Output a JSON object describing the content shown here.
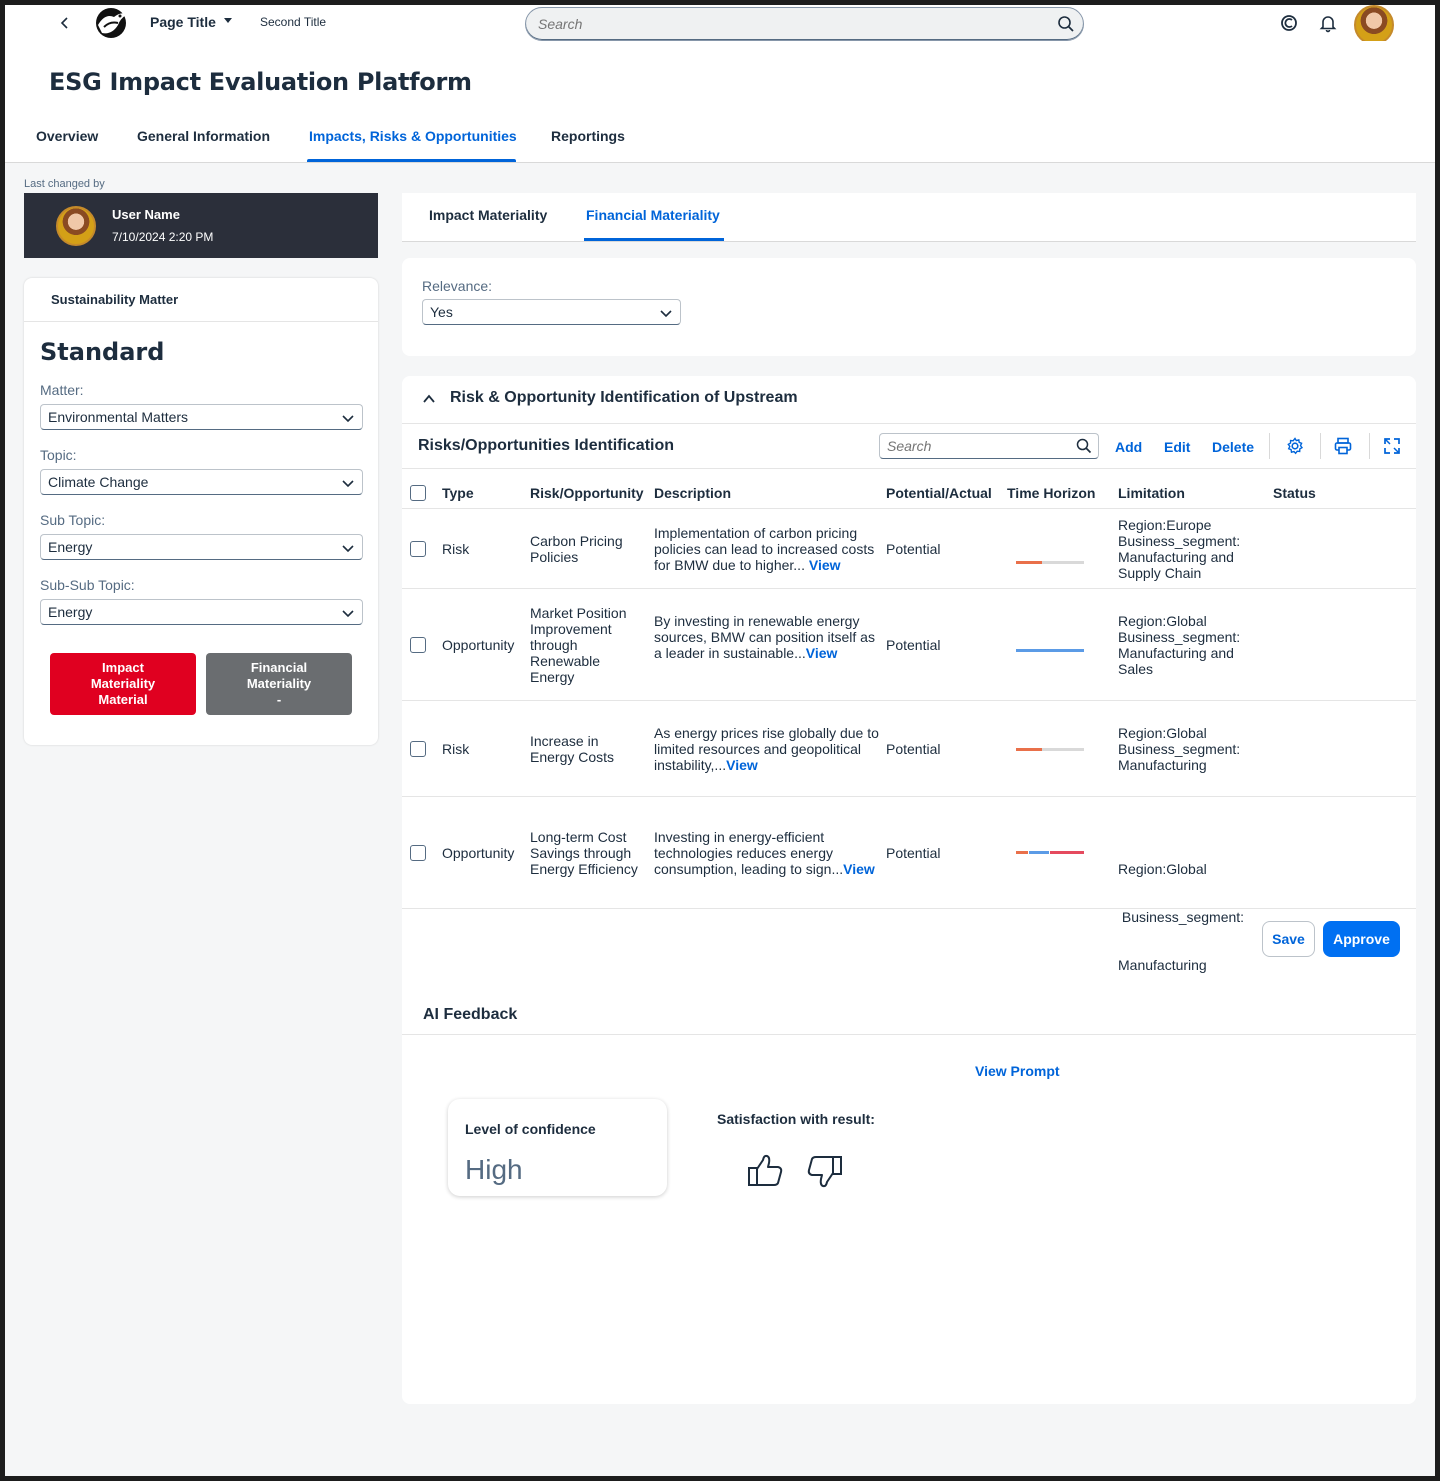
{
  "shell": {
    "page_title": "Page Title",
    "second_title": "Second Title",
    "search_placeholder": "Search"
  },
  "header": {
    "title": "ESG Impact Evaluation Platform"
  },
  "nav": {
    "tabs": [
      {
        "label": "Overview"
      },
      {
        "label": "General Information"
      },
      {
        "label": "Impacts, Risks & Opportunities"
      },
      {
        "label": "Reportings"
      }
    ],
    "active_index": 2
  },
  "left": {
    "last_changed_label": "Last changed by",
    "user_name": "User Name",
    "user_date": "7/10/2024 2:20 PM",
    "card_title": "Sustainability Matter",
    "standard": "Standard",
    "fields": [
      {
        "label": "Matter:",
        "value": "Environmental Matters"
      },
      {
        "label": "Topic:",
        "value": "Climate Change"
      },
      {
        "label": "Sub Topic:",
        "value": "Energy"
      },
      {
        "label": "Sub-Sub Topic:",
        "value": "Energy"
      }
    ],
    "impact_btn": [
      "Impact",
      "Materiality",
      "Material"
    ],
    "financial_btn": [
      "Financial",
      "Materiality",
      "-"
    ]
  },
  "subtabs": {
    "tabs": [
      {
        "label": "Impact Materiality"
      },
      {
        "label": "Financial Materiality"
      }
    ],
    "active_index": 1
  },
  "relevance": {
    "label": "Relevance:",
    "value": "Yes"
  },
  "risk": {
    "section_title": "Risk & Opportunity Identification of Upstream",
    "table_title": "Risks/Opportunities Identification",
    "search_placeholder": "Search",
    "actions": {
      "add": "Add",
      "edit": "Edit",
      "delete": "Delete"
    },
    "columns": [
      "Type",
      "Risk/Opportunity",
      "Description",
      "Potential/Actual",
      "Time Horizon",
      "Limitation",
      "Status"
    ],
    "view_label": "View",
    "rows": [
      {
        "type": "Risk",
        "name": [
          "Carbon Pricing",
          "Policies"
        ],
        "desc": [
          "Implementation of carbon pricing",
          "policies can lead to increased costs",
          "for BMW due to higher... "
        ],
        "potential": "Potential",
        "limitation": [
          "Region:Europe",
          "Business_segment:",
          "Manufacturing and",
          "Supply Chain"
        ],
        "status": "",
        "horizon": "short"
      },
      {
        "type": "Opportunity",
        "name": [
          "Market Position",
          "Improvement",
          "through",
          "Renewable",
          "Energy"
        ],
        "desc": [
          "By investing in renewable energy",
          "sources, BMW can position itself as",
          "a leader in sustainable..."
        ],
        "potential": "Potential",
        "limitation": [
          "Region:Global",
          "Business_segment:",
          "Manufacturing and",
          "Sales"
        ],
        "status": "",
        "horizon": "long"
      },
      {
        "type": "Risk",
        "name": [
          "Increase in",
          "Energy Costs"
        ],
        "desc": [
          "As energy prices rise globally due to",
          "limited resources and geopolitical",
          "instability,..."
        ],
        "potential": "Potential",
        "limitation": [
          "Region:Global",
          "Business_segment:",
          "Manufacturing"
        ],
        "status": "",
        "horizon": "short"
      },
      {
        "type": "Opportunity",
        "name": [
          "Long-term Cost",
          "Savings through",
          "Energy Efficiency"
        ],
        "desc": [
          "Investing in energy-efficient",
          "technologies reduces energy",
          "consumption, leading to sign..."
        ],
        "potential": "Potential",
        "limitation": [
          "Region:Global",
          " Business_segment:",
          "Manufacturing"
        ],
        "status": "",
        "horizon": "multi"
      }
    ],
    "save_label": "Save",
    "approve_label": "Approve"
  },
  "ai": {
    "title": "AI Feedback",
    "view_prompt": "View Prompt",
    "confidence_label": "Level of confidence",
    "confidence_value": "High",
    "satisfaction_label": "Satisfaction with result:"
  },
  "colors": {
    "accent": "#0064d9",
    "impact_red": "#e00020",
    "gray_btn": "#6a6d70",
    "horizon_short": "#e9704a",
    "horizon_long": "#5b9be6",
    "horizon_multi_red": "#e54a5e"
  }
}
